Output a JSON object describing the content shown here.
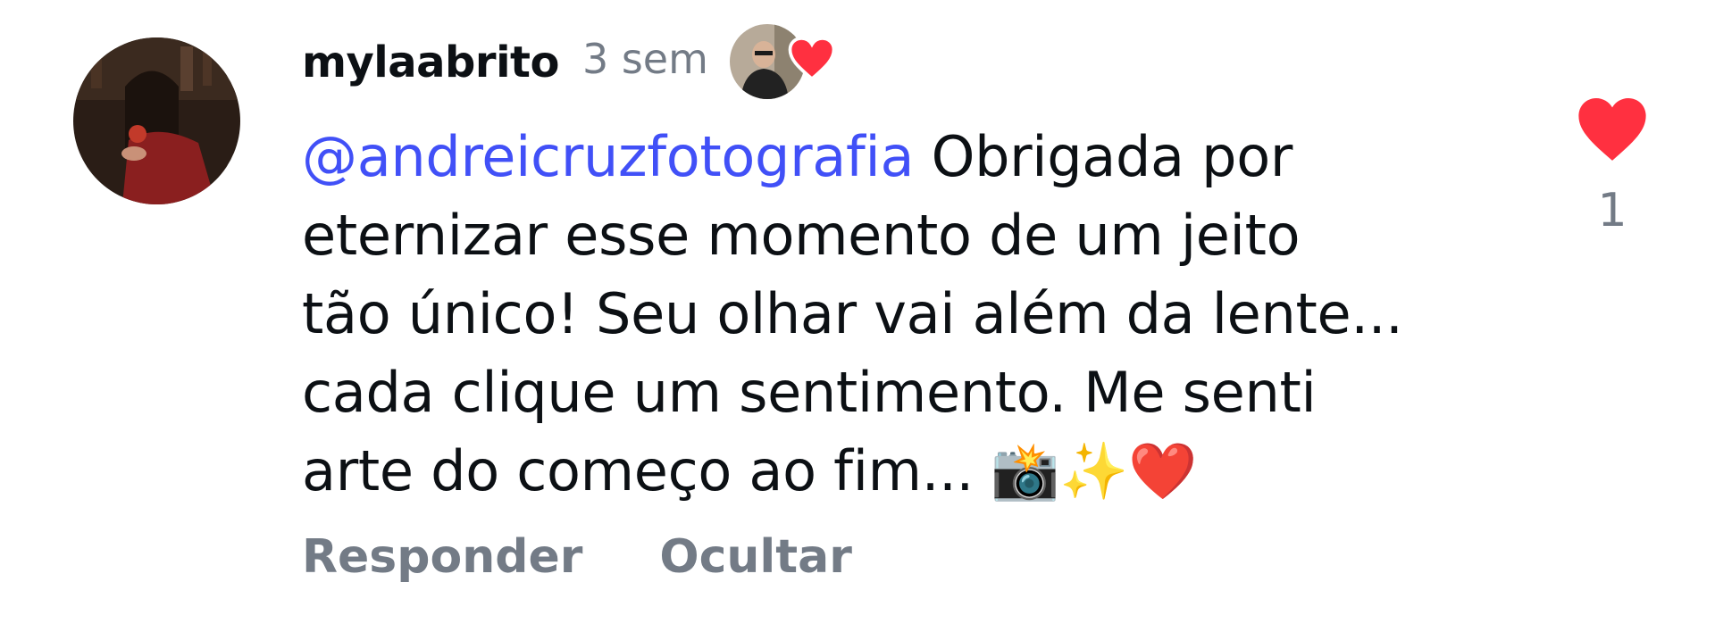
{
  "comment": {
    "username": "mylaabrito",
    "timestamp": "3 sem",
    "avatar_icon": "user-avatar-photo",
    "creator_liked": true,
    "mention": "@andreicruzfotografia",
    "text_lines": [
      " Obrigada por",
      "eternizar esse momento de um jeito",
      "tão único! Seu olhar vai além da lente...",
      "cada clique um sentimento. Me senti",
      "arte do começo ao fim... "
    ],
    "emojis": "📸✨❤️",
    "actions": {
      "reply_label": "Responder",
      "hide_label": "Ocultar"
    },
    "like_count": "1",
    "liked": true
  },
  "colors": {
    "text": "#0c1014",
    "secondary": "#737b86",
    "mention": "#4150f7",
    "like_red": "#ff3040"
  }
}
